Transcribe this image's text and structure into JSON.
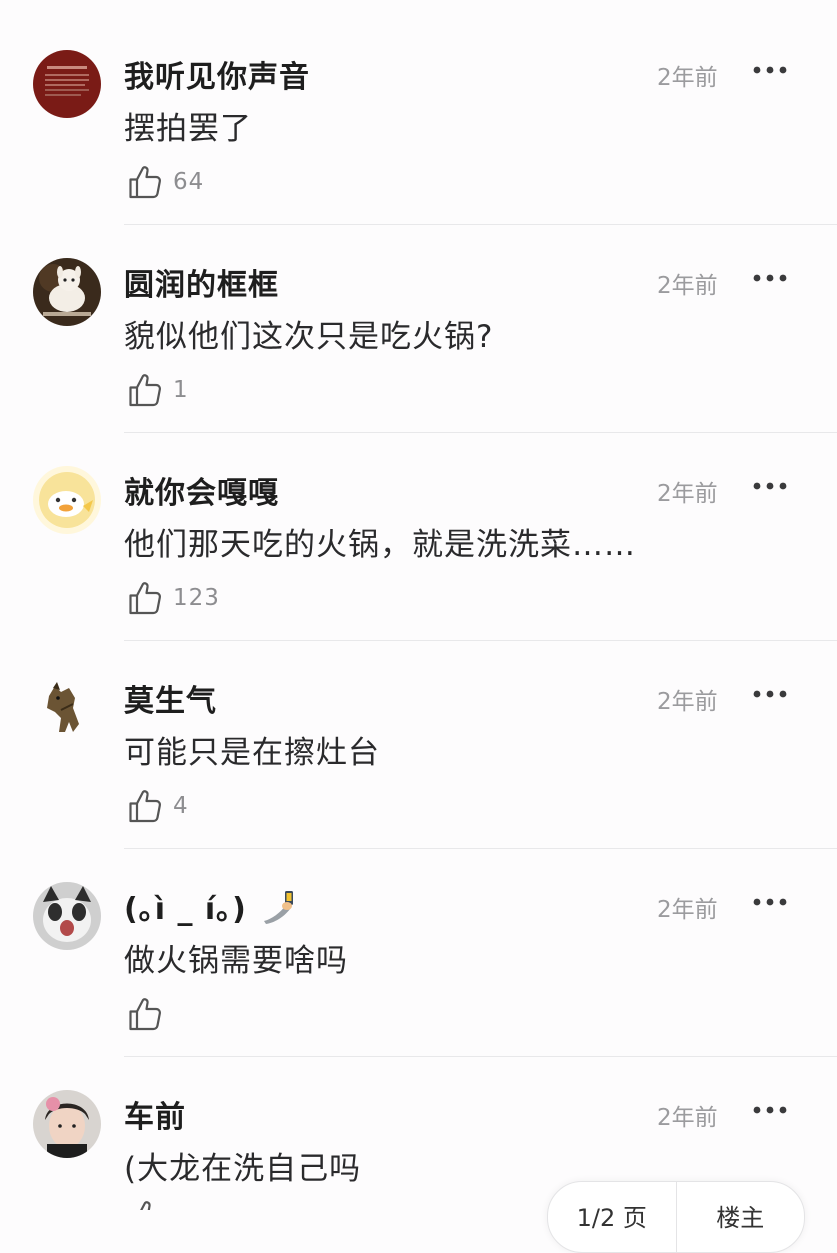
{
  "comments": [
    {
      "user": "我听见你声音",
      "time": "2年前",
      "text": "摆拍罢了",
      "likes": "64",
      "avatar": "red-poster-avatar"
    },
    {
      "user": "圆润的框框",
      "time": "2年前",
      "text": "貌似他们这次只是吃火锅?",
      "likes": "1",
      "avatar": "alpaca-avatar"
    },
    {
      "user": "就你会嘎嘎",
      "time": "2年前",
      "text": "他们那天吃的火锅，就是洗洗菜……",
      "likes": "123",
      "avatar": "cartoon-duck-avatar"
    },
    {
      "user": "莫生气",
      "time": "2年前",
      "text": "可能只是在擦灶台",
      "likes": "4",
      "avatar": "horse-avatar"
    },
    {
      "user": "(｡ì _ í｡)",
      "time": "2年前",
      "text": "做火锅需要啥吗",
      "likes": "",
      "avatar": "cat-avatar"
    },
    {
      "user": "车前",
      "time": "2年前",
      "text": "(大龙在洗自己吗",
      "likes": "",
      "avatar": "girl-avatar"
    }
  ],
  "pager": {
    "page": "1/2 页",
    "next": "楼主"
  },
  "icons": {
    "like": "thumbs-up-icon",
    "more": "more-dots-icon",
    "emoji": "phone-hand-emoji"
  },
  "colors": {
    "background": "#fdfcfd",
    "username": "#1e1e1e",
    "meta": "#9b9b9e",
    "divider": "#e8e8ea"
  }
}
